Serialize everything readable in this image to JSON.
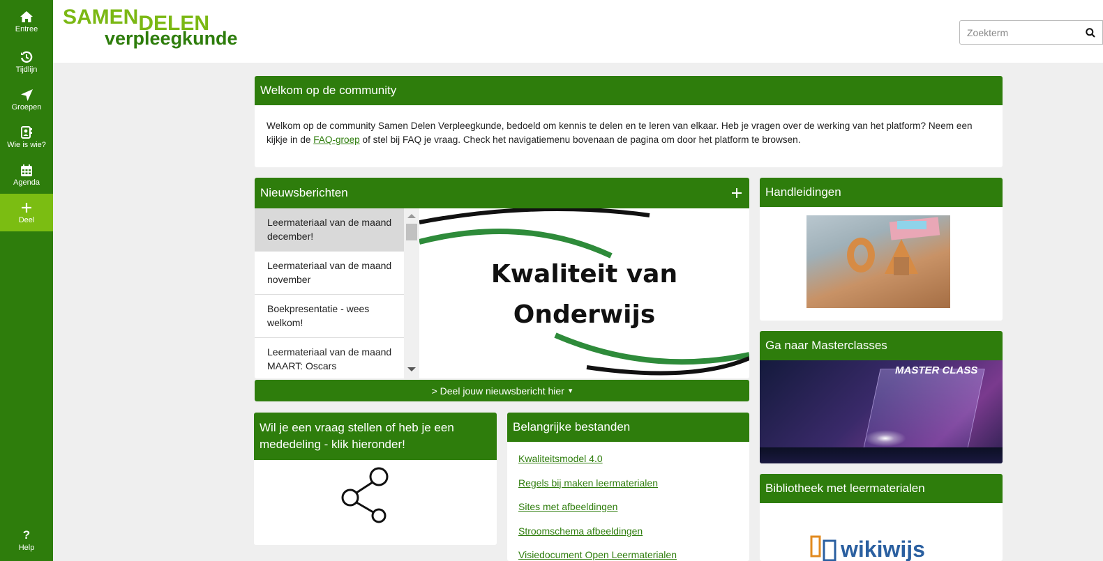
{
  "nav": {
    "items": [
      {
        "label": "Entree"
      },
      {
        "label": "Tijdlijn"
      },
      {
        "label": "Groepen"
      },
      {
        "label": "Wie is wie?"
      },
      {
        "label": "Agenda"
      },
      {
        "label": "Deel"
      }
    ],
    "help": "Help"
  },
  "header": {
    "logo_line1_a": "SAMEN",
    "logo_line1_b": "DELEN",
    "logo_line2": "verpleegkunde",
    "search_placeholder": "Zoekterm"
  },
  "welcome": {
    "title": "Welkom op de community",
    "text_before": "Welkom op de community Samen Delen Verpleegkunde, bedoeld om kennis te delen en te leren van elkaar. Heb je vragen over de werking van het platform? Neem een kijkje in de ",
    "link": "FAQ-groep",
    "text_after": " of stel bij FAQ je vraag. Check het navigatiemenu bovenaan de pagina om door het platform te browsen."
  },
  "news": {
    "title": "Nieuwsberichten",
    "add_icon": "plus-icon",
    "items": [
      {
        "label": "Leermateriaal van de maand december!"
      },
      {
        "label": "Leermateriaal van de maand november"
      },
      {
        "label": "Boekpresentatie - wees welkom!"
      },
      {
        "label": "Leermateriaal van de maand MAART: Oscars"
      }
    ],
    "image_line1": "Kwaliteit van",
    "image_line2": "Onderwijs",
    "share_label": "> Deel jouw nieuwsbericht hier",
    "share_caret": "▾"
  },
  "handleidingen": {
    "title": "Handleidingen"
  },
  "masterclasses": {
    "title": "Ga naar Masterclasses",
    "banner_a": "MASTER",
    "banner_b": "CLASS"
  },
  "question": {
    "title": "Wil je een vraag stellen of heb je een mededeling - klik hieronder!"
  },
  "files": {
    "title": "Belangrijke bestanden",
    "items": [
      {
        "label": "Kwaliteitsmodel 4.0"
      },
      {
        "label": "Regels bij maken leermaterialen"
      },
      {
        "label": "Sites met afbeeldingen"
      },
      {
        "label": "Stroomschema afbeeldingen"
      },
      {
        "label": "Visiedocument Open Leermaterialen"
      }
    ]
  },
  "bibliotheek": {
    "title": "Bibliotheek met leermaterialen",
    "logo_text": "wikiwijs"
  },
  "colors": {
    "dark_green": "#2e7d0c",
    "light_green": "#7bbd12",
    "background": "#efefef"
  }
}
